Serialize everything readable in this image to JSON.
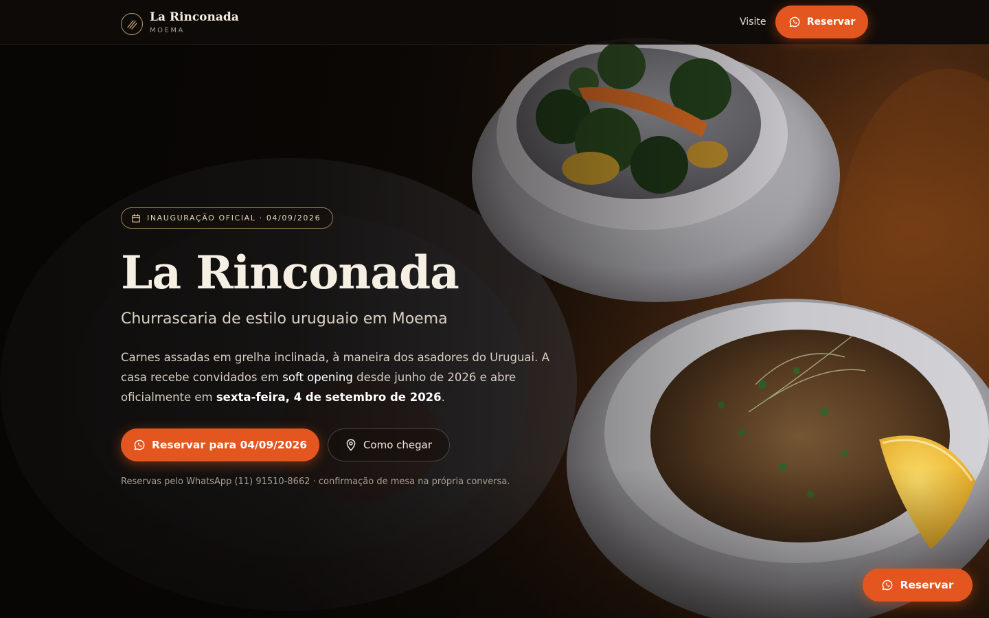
{
  "header": {
    "brand_name": "La Rinconada",
    "brand_sub": "MOEMA",
    "nav_visite": "Visite",
    "reservar_label": "Reservar"
  },
  "hero": {
    "badge": "INAUGURAÇÃO OFICIAL · 04/09/2026",
    "title": "La Rinconada",
    "subtitle": "Churrascaria de estilo uruguaio em Moema",
    "description": {
      "part1": "Carnes assadas em grelha inclinada, à maneira dos asadores do Uruguai. A casa recebe convidados em ",
      "highlight1": "soft opening",
      "part2": " desde junho de 2026 e abre oficialmente em ",
      "highlight2": "sexta-feira, 4 de setembro de 2026",
      "part3": "."
    },
    "cta_primary": "Reservar para 04/09/2026",
    "cta_secondary": "Como chegar",
    "note": "Reservas pelo WhatsApp (11) 91510-8662 · confirmação de mesa na própria conversa."
  },
  "floating": {
    "reservar_label": "Reservar"
  },
  "colors": {
    "accent": "#e4561f",
    "background": "#0e0a07",
    "badge_border": "#9b7d55"
  },
  "icons": {
    "brand": "grill-lines-icon",
    "whatsapp": "whatsapp-icon",
    "calendar": "calendar-icon",
    "location": "map-pin-icon"
  }
}
